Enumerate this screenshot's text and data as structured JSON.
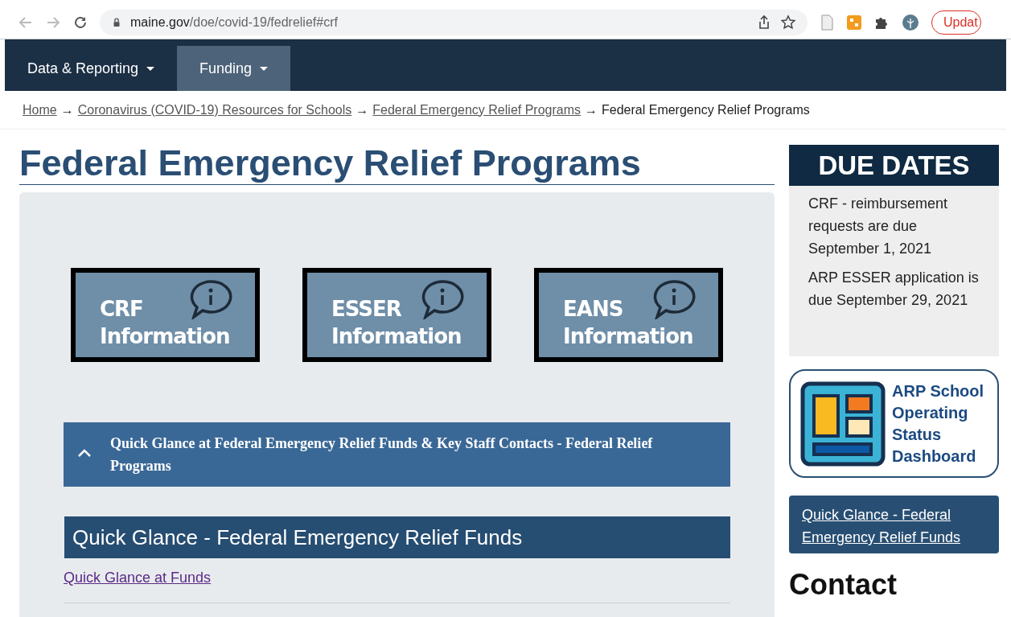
{
  "browser": {
    "url_host": "maine.gov",
    "url_path": "/doe/covid-19/fedrelief#crf",
    "update_button": "Updat"
  },
  "nav": [
    {
      "label": "Data & Reporting",
      "selected": false
    },
    {
      "label": "Funding",
      "selected": true
    }
  ],
  "breadcrumb": [
    {
      "label": "Home",
      "kind": "link"
    },
    {
      "label": "→",
      "kind": "sep"
    },
    {
      "label": "Coronavirus (COVID-19) Resources for Schools",
      "kind": "link"
    },
    {
      "label": "→",
      "kind": "sep"
    },
    {
      "label": "Federal Emergency Relief Programs",
      "kind": "link"
    },
    {
      "label": "→",
      "kind": "sep"
    },
    {
      "label": "Federal Emergency Relief Programs",
      "kind": "current"
    }
  ],
  "page_title": "Federal Emergency Relief Programs",
  "info_tiles": [
    {
      "title": "CRF",
      "subtitle": "Information"
    },
    {
      "title": "ESSER",
      "subtitle": "Information"
    },
    {
      "title": "EANS",
      "subtitle": "Information"
    }
  ],
  "accordion": {
    "label": "Quick Glance at Federal Emergency Relief Funds & Key Staff Contacts - Federal Relief Programs",
    "expanded": true
  },
  "section_heading": "Quick Glance - Federal Emergency Relief Funds",
  "section_link": "Quick Glance at Funds",
  "sidebar": {
    "due_dates_title": "DUE DATES",
    "due_dates": [
      "CRF - reimbursement requests are due September 1, 2021",
      "ARP ESSER application is due September 29, 2021"
    ],
    "dashboard_label": "ARP School Operating Status Dashboard",
    "quick_link": "Quick Glance - Federal Emergency Relief Funds",
    "contact_heading": "Contact"
  }
}
